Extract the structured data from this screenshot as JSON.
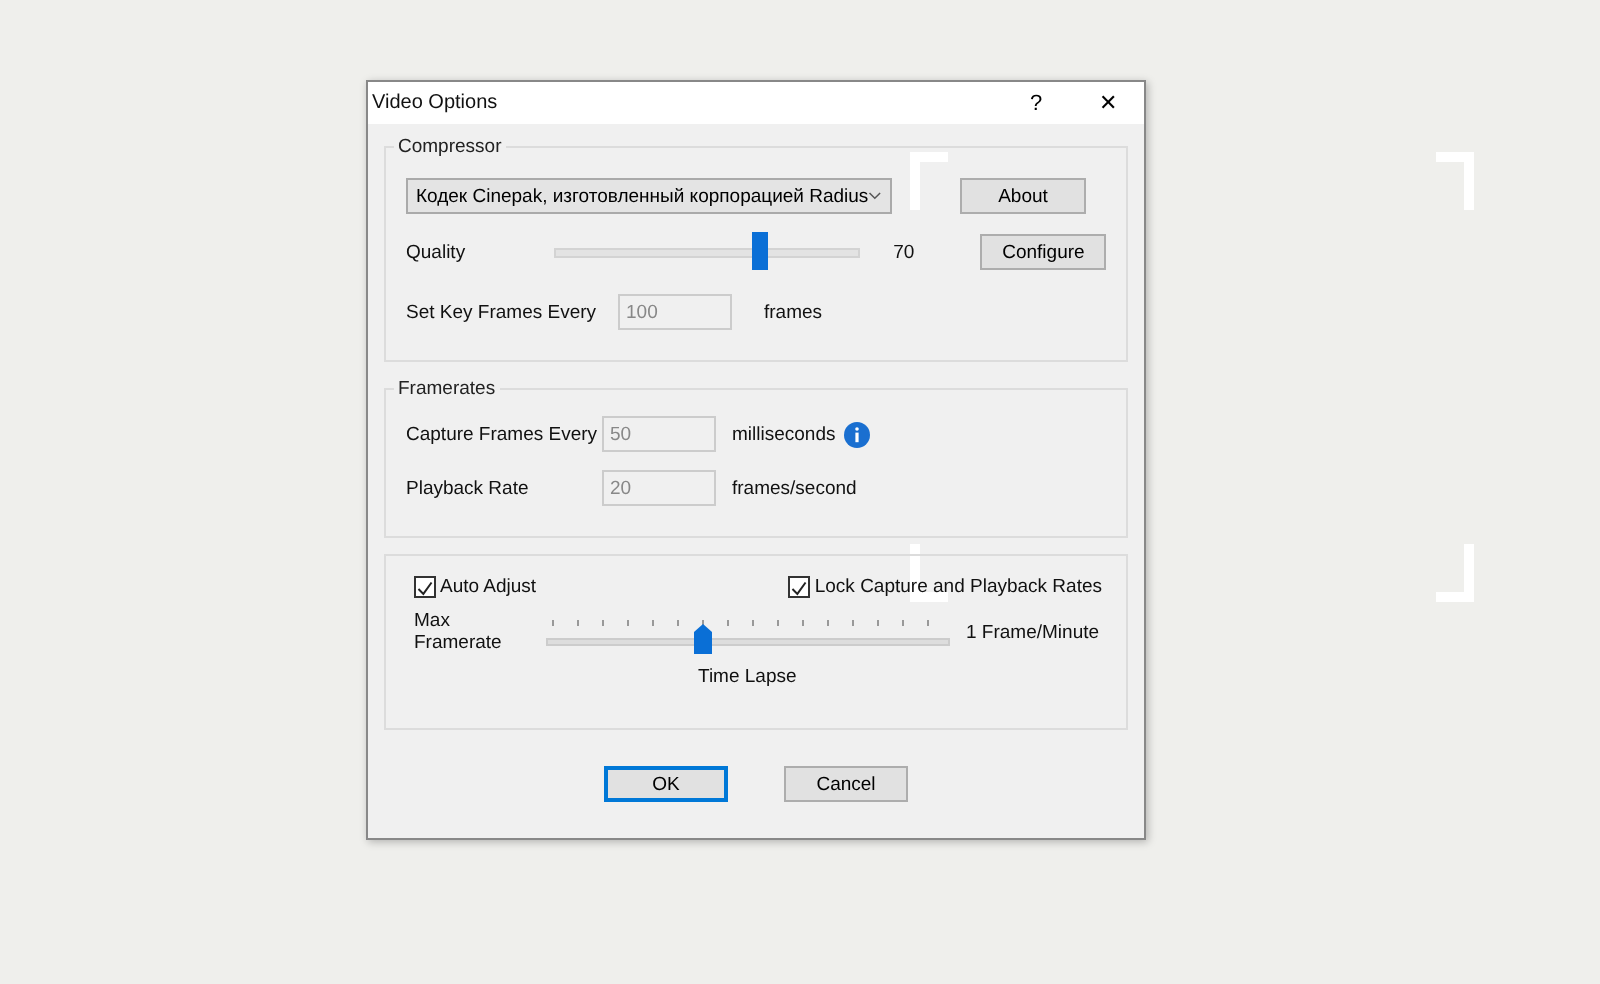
{
  "window": {
    "title": "Video Options",
    "help_button": "?",
    "close_button": "✕"
  },
  "compressor": {
    "title": "Compressor",
    "codec": "Кодек Cinepak, изготовленный корпорацией Radius",
    "about_button": "About",
    "configure_button": "Configure",
    "quality_label": "Quality",
    "quality": {
      "level": 0.68
    },
    "quality_value": "70",
    "keyframes_label": "Set Key Frames Every",
    "keyframes_value": "100",
    "keyframes_unit": "frames"
  },
  "framerates": {
    "title": "Framerates",
    "capture_label": "Capture Frames Every",
    "capture_value": "50",
    "capture_unit": "milliseconds",
    "playback_label": "Playback Rate",
    "playback_value": "20",
    "playback_unit": "frames/second"
  },
  "adjust": {
    "auto_adjust": {
      "label": "Auto Adjust",
      "checked": true
    },
    "lock_rates": {
      "label": "Lock Capture and Playback Rates",
      "checked": true
    },
    "max_label": "Max\nFramerate",
    "framerate": {
      "level": 0.385
    },
    "max_value": "1 Frame/Minute",
    "caption": "Time Lapse"
  },
  "buttons": [
    {
      "label": "OK",
      "default": true
    },
    {
      "label": "Cancel",
      "default": false
    }
  ]
}
